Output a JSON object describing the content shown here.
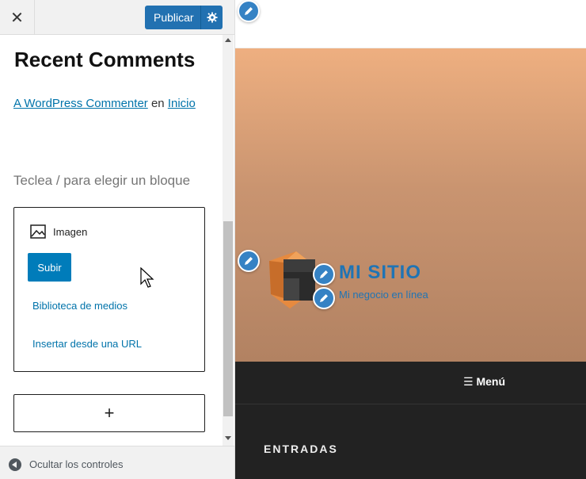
{
  "header": {
    "close_icon": "close-icon",
    "publish_label": "Publicar",
    "settings_icon": "gear-icon"
  },
  "widget": {
    "title": "Recent Comments",
    "comment": {
      "author": "A WordPress Commenter",
      "connector": "en",
      "post": "Inicio"
    }
  },
  "editor": {
    "block_hint": "Teclea / para elegir un bloque",
    "image_block": {
      "label": "Imagen",
      "upload_label": "Subir",
      "media_library_label": "Biblioteca de medios",
      "insert_url_label": "Insertar desde una URL"
    },
    "add_block_label": "+"
  },
  "footer": {
    "hide_controls_label": "Ocultar los controles"
  },
  "preview": {
    "site_title": "MI SITIO",
    "site_tagline": "Mi negocio en línea",
    "menu_label": "Menú",
    "menu_icon": "hamburger-icon",
    "section_heading": "ENTRADAS",
    "edit_icon": "pencil-icon"
  },
  "colors": {
    "accent": "#2271b1",
    "link": "#0073aa",
    "site_title": "#1f74b5",
    "hero_top": "#eeaf80",
    "hero_bottom": "#b28262",
    "dark_bg": "#222222"
  }
}
